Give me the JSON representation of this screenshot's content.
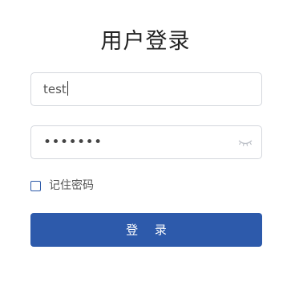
{
  "form": {
    "title": "用户登录",
    "username_value": "test",
    "password_value": "•••••••",
    "remember_label": "记住密码",
    "remember_checked": false,
    "submit_label": "登 录"
  },
  "icons": {
    "password_toggle": "eye-closed-icon"
  },
  "colors": {
    "accent": "#2d5aab",
    "border": "#d4d7dd",
    "title": "#222222"
  }
}
